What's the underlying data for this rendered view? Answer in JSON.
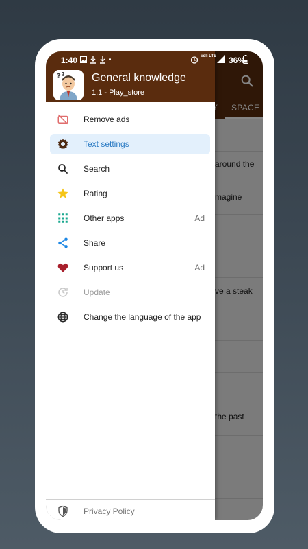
{
  "status_bar": {
    "time": "1:40",
    "battery": "36%",
    "network": "Voli LTE"
  },
  "app": {
    "tabs": [
      {
        "label": "Y"
      },
      {
        "label": "SPACE"
      }
    ],
    "rows": [
      {
        "text": "around the"
      },
      {
        "text": "magine"
      },
      {
        "text": "ve a steak"
      },
      {
        "text": "the past"
      }
    ]
  },
  "drawer": {
    "title": "General knowledge",
    "subtitle": "1.1 - Play_store",
    "items": [
      {
        "label": "Remove ads",
        "icon": "no-ads-icon",
        "ad": ""
      },
      {
        "label": "Text settings",
        "icon": "gear-icon",
        "ad": ""
      },
      {
        "label": "Search",
        "icon": "search-icon",
        "ad": ""
      },
      {
        "label": "Rating",
        "icon": "star-icon",
        "ad": ""
      },
      {
        "label": "Other apps",
        "icon": "grid-icon",
        "ad": "Ad"
      },
      {
        "label": "Share",
        "icon": "share-icon",
        "ad": ""
      },
      {
        "label": "Support us",
        "icon": "heart-icon",
        "ad": "Ad"
      },
      {
        "label": "Update",
        "icon": "update-icon",
        "ad": ""
      },
      {
        "label": "Change the language of the app",
        "icon": "globe-icon",
        "ad": ""
      }
    ],
    "footer": {
      "label": "Privacy Policy",
      "icon": "shield-icon"
    }
  },
  "colors": {
    "brand": "#5a2c0e",
    "selected_bg": "#e3f0fc",
    "selected_text": "#2b7bc4"
  }
}
